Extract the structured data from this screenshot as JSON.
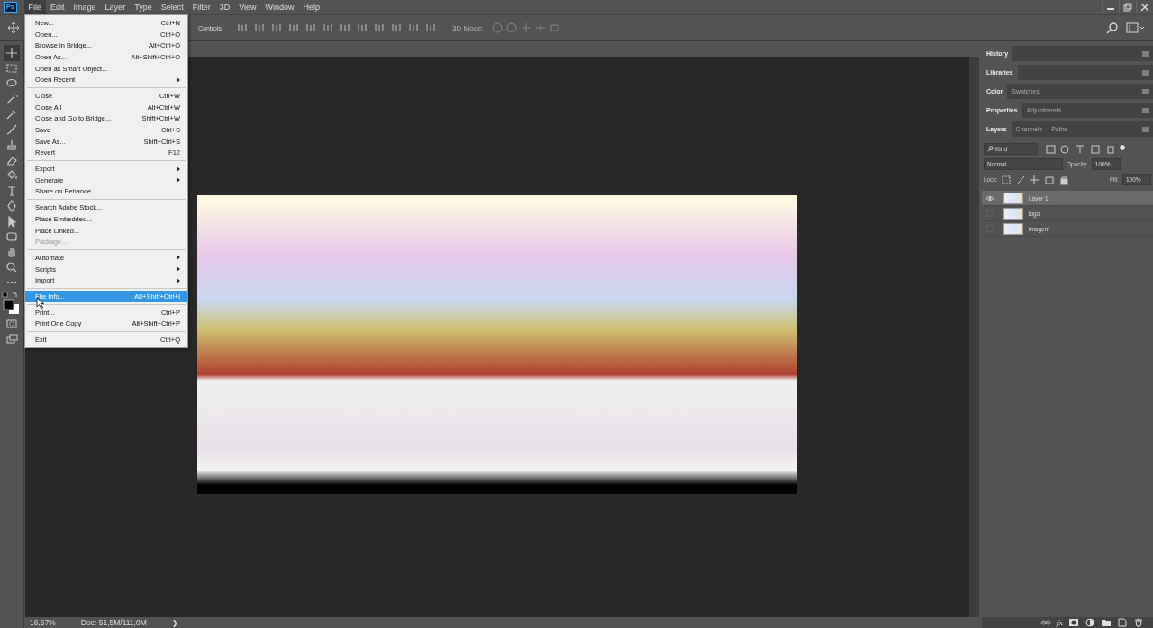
{
  "menubar": {
    "app_badge": "Ps",
    "items": [
      {
        "label": "File",
        "selected": true
      },
      {
        "label": "Edit",
        "selected": false
      },
      {
        "label": "Image",
        "selected": false
      },
      {
        "label": "Layer",
        "selected": false
      },
      {
        "label": "Type",
        "selected": false
      },
      {
        "label": "Select",
        "selected": false
      },
      {
        "label": "Filter",
        "selected": false
      },
      {
        "label": "3D",
        "selected": false
      },
      {
        "label": "View",
        "selected": false
      },
      {
        "label": "Window",
        "selected": false
      },
      {
        "label": "Help",
        "selected": false
      }
    ]
  },
  "options_bar": {
    "transform_label": "Controls",
    "mode_label": "3D Mode:"
  },
  "file_menu": {
    "groups": [
      [
        {
          "label": "New...",
          "shortcut": "Ctrl+N",
          "submenu": false,
          "disabled": false,
          "selected": false
        },
        {
          "label": "Open...",
          "shortcut": "Ctrl+O",
          "submenu": false,
          "disabled": false,
          "selected": false
        },
        {
          "label": "Browse in Bridge...",
          "shortcut": "Alt+Ctrl+O",
          "submenu": false,
          "disabled": false,
          "selected": false
        },
        {
          "label": "Open As...",
          "shortcut": "Alt+Shift+Ctrl+O",
          "submenu": false,
          "disabled": false,
          "selected": false
        },
        {
          "label": "Open as Smart Object...",
          "submenu": false,
          "disabled": false,
          "selected": false
        },
        {
          "label": "Open Recent",
          "submenu": true,
          "disabled": false,
          "selected": false
        }
      ],
      [
        {
          "label": "Close",
          "shortcut": "Ctrl+W",
          "submenu": false,
          "disabled": false,
          "selected": false
        },
        {
          "label": "Close All",
          "shortcut": "Alt+Ctrl+W",
          "submenu": false,
          "disabled": false,
          "selected": false
        },
        {
          "label": "Close and Go to Bridge...",
          "shortcut": "Shift+Ctrl+W",
          "submenu": false,
          "disabled": false,
          "selected": false
        },
        {
          "label": "Save",
          "shortcut": "Ctrl+S",
          "submenu": false,
          "disabled": false,
          "selected": false
        },
        {
          "label": "Save As...",
          "shortcut": "Shift+Ctrl+S",
          "submenu": false,
          "disabled": false,
          "selected": false
        },
        {
          "label": "Revert",
          "shortcut": "F12",
          "submenu": false,
          "disabled": false,
          "selected": false
        }
      ],
      [
        {
          "label": "Export",
          "submenu": true,
          "disabled": false,
          "selected": false
        },
        {
          "label": "Generate",
          "submenu": true,
          "disabled": false,
          "selected": false
        },
        {
          "label": "Share on Behance...",
          "submenu": false,
          "disabled": false,
          "selected": false
        }
      ],
      [
        {
          "label": "Search Adobe Stock...",
          "submenu": false,
          "disabled": false,
          "selected": false
        },
        {
          "label": "Place Embedded...",
          "submenu": false,
          "disabled": false,
          "selected": false
        },
        {
          "label": "Place Linked...",
          "submenu": false,
          "disabled": false,
          "selected": false
        },
        {
          "label": "Package...",
          "submenu": false,
          "disabled": true,
          "selected": false
        }
      ],
      [
        {
          "label": "Automate",
          "submenu": true,
          "disabled": false,
          "selected": false
        },
        {
          "label": "Scripts",
          "submenu": true,
          "disabled": false,
          "selected": false
        },
        {
          "label": "Import",
          "submenu": true,
          "disabled": false,
          "selected": false
        }
      ],
      [
        {
          "label": "File Info...",
          "shortcut": "Alt+Shift+Ctrl+I",
          "submenu": false,
          "disabled": false,
          "selected": true
        }
      ],
      [
        {
          "label": "Print...",
          "shortcut": "Ctrl+P",
          "submenu": false,
          "disabled": false,
          "selected": false
        },
        {
          "label": "Print One Copy",
          "shortcut": "Alt+Shift+Ctrl+P",
          "submenu": false,
          "disabled": false,
          "selected": false
        }
      ],
      [
        {
          "label": "Exit",
          "shortcut": "Ctrl+Q",
          "submenu": false,
          "disabled": false,
          "selected": false
        }
      ]
    ]
  },
  "panel_groups": [
    [
      {
        "label": "History",
        "selected": true
      }
    ],
    [
      {
        "label": "Libraries",
        "selected": true
      }
    ],
    [
      {
        "label": "Color",
        "selected": true
      },
      {
        "label": "Swatches",
        "selected": false
      }
    ],
    [
      {
        "label": "Properties",
        "selected": true
      },
      {
        "label": "Adjustments",
        "selected": false
      }
    ]
  ],
  "layers_panel": {
    "tabs": [
      {
        "label": "Layers",
        "selected": true
      },
      {
        "label": "Channels",
        "selected": false
      },
      {
        "label": "Paths",
        "selected": false
      }
    ],
    "filter": "Kind",
    "blend_mode": "Normal",
    "opacity_label": "Opacity:",
    "opacity": "100%",
    "lock_label": "Lock:",
    "fill_label": "Fill:",
    "fill": "100%",
    "layers": [
      {
        "name": "Layer 1",
        "visible": true,
        "selected": true
      },
      {
        "name": "logo",
        "visible": false,
        "selected": false
      },
      {
        "name": "imagem",
        "visible": false,
        "selected": false
      }
    ],
    "footer_fx": "fx"
  },
  "status_bar": {
    "zoom": "16,67%",
    "doc": "Doc: 51,5M/111,0M",
    "arrow": "❯"
  }
}
